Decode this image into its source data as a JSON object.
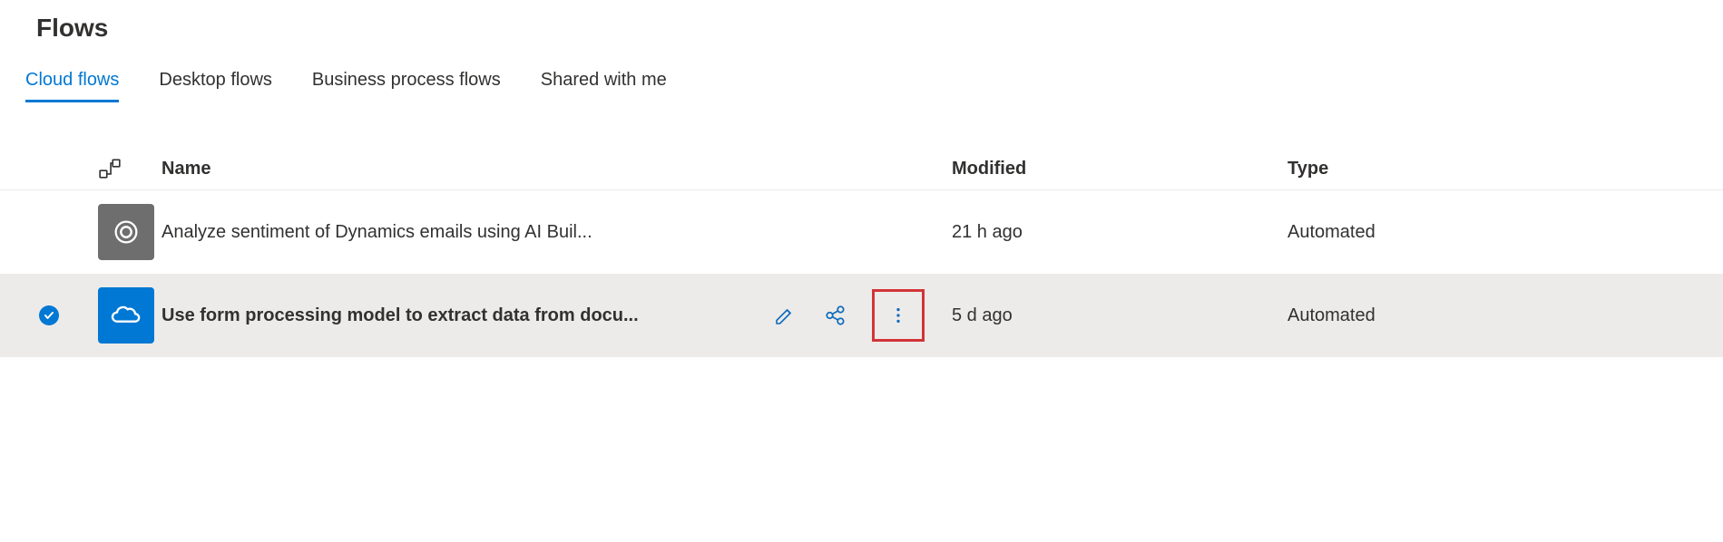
{
  "page": {
    "title": "Flows"
  },
  "tabs": [
    {
      "label": "Cloud flows",
      "active": true
    },
    {
      "label": "Desktop flows",
      "active": false
    },
    {
      "label": "Business process flows",
      "active": false
    },
    {
      "label": "Shared with me",
      "active": false
    }
  ],
  "columns": {
    "name": "Name",
    "modified": "Modified",
    "type": "Type"
  },
  "rows": [
    {
      "selected": false,
      "icon_style": "gray",
      "icon_name": "dynamics-icon",
      "name": "Analyze sentiment of Dynamics emails using AI Buil...",
      "modified": "21 h ago",
      "type": "Automated"
    },
    {
      "selected": true,
      "icon_style": "blue",
      "icon_name": "onedrive-icon",
      "name": "Use form processing model to extract data from docu...",
      "modified": "5 d ago",
      "type": "Automated"
    }
  ],
  "actions": {
    "edit": "Edit",
    "share": "Share",
    "more": "More"
  },
  "colors": {
    "accent": "#0078d4",
    "highlight": "#d13438"
  }
}
